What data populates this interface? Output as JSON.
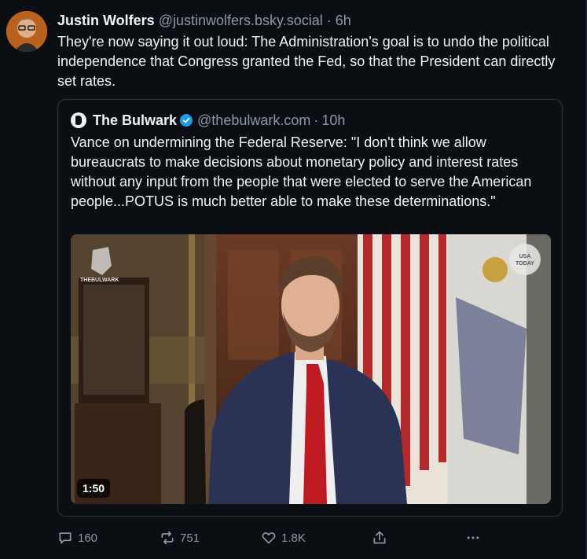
{
  "post": {
    "author_name": "Justin Wolfers",
    "author_handle": "@justinwolfers.bsky.social",
    "separator": "·",
    "time": "6h",
    "text": "They're now saying it out loud: The Administration's goal is to undo the political independence that Congress granted the Fed, so that the President can directly set rates."
  },
  "quote": {
    "author_name": "The Bulwark",
    "author_handle": "@thebulwark.com",
    "separator": "·",
    "time": "10h",
    "text": "Vance on undermining the Federal Reserve: \"I don't think we allow bureaucrats to make decisions about monetary policy and interest rates without any input from the people that were elected to serve the American people...POTUS is much better able to make these determinations.\"",
    "video": {
      "duration": "1:50",
      "watermark_left": "THEBULWARK",
      "watermark_right": "USA TODAY"
    }
  },
  "actions": {
    "replies": "160",
    "reposts": "751",
    "likes": "1.8K"
  },
  "colors": {
    "background": "#0b0f14",
    "text": "#f1f3f5",
    "muted": "#8b98a5",
    "verified": "#1d9bf0",
    "border": "#2d343d"
  }
}
